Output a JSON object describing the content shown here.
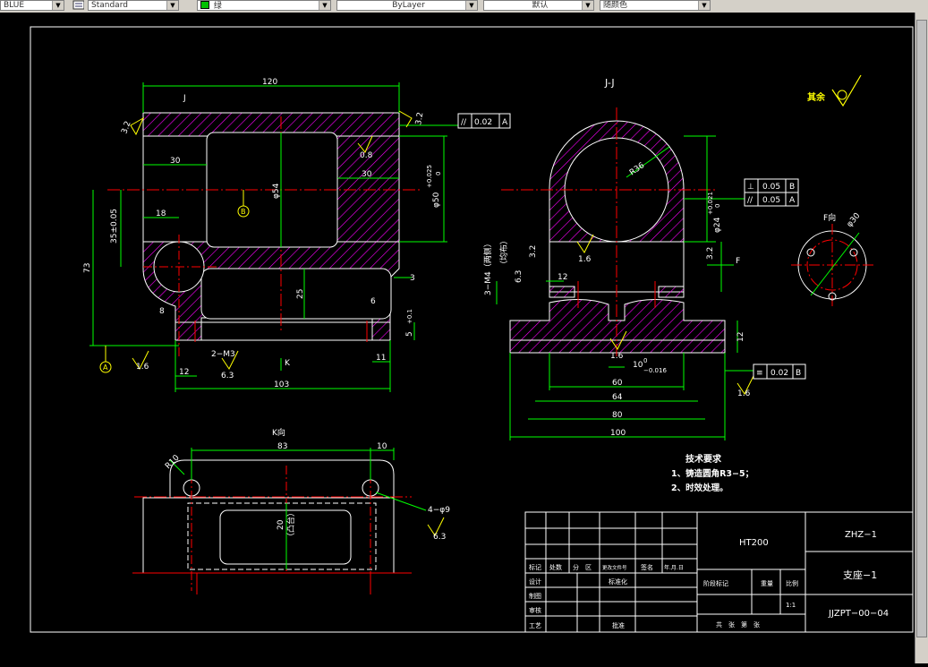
{
  "toolbar": {
    "layer": "BLUE",
    "text_style": "Standard",
    "color": "绿",
    "linetype": "ByLayer",
    "lineweight": "默认",
    "plot_style": "随颜色"
  },
  "colors": {
    "outline": "#ffffff",
    "dimension": "#00ff00",
    "centerline": "#ff0000",
    "hatch": "#ff00ff",
    "label": "#ffff00"
  },
  "drawing": {
    "front_view": {
      "section_label": "J",
      "dim_width": "120",
      "dim_30_left": "30",
      "dim_30_right": "30",
      "dim_18": "18",
      "dim_35": "35±0.05",
      "dim_73": "73",
      "dim_54": "φ54",
      "dim_50": "φ50",
      "tol_50": "+0.025",
      "tol_50b": "0",
      "dim_25": "25",
      "dim_3": "3",
      "dim_6": "6",
      "dim_5": "5",
      "tol_5": "+0.1",
      "dim_11": "11",
      "dim_12": "12",
      "dim_103": "103",
      "dim_8": "8",
      "dim_m3": "2−M3",
      "rough_32_left": "3.2",
      "rough_32_right": "3.2",
      "rough_08": "0.8",
      "rough_16": "1.6",
      "rough_63": "6.3",
      "datum_b": "B",
      "datum_a": "A",
      "view_k_arrow": "K",
      "tol_parallel_symbol": "//",
      "tol_parallel_val": "0.02",
      "tol_parallel_ref": "A"
    },
    "section_view": {
      "title": "J-J",
      "dim_r36": "R36",
      "dim_24": "φ24",
      "tol_24": "+0.021",
      "tol_24b": "0",
      "dim_m4": "3−M4（两侧）",
      "dim_m4_b": "（均布）",
      "rough_63": "6.3",
      "rough_32_left": "3.2",
      "rough_32_right": "3.2",
      "rough_16": "1.6",
      "rough_16b": "1.6",
      "rough_16c": "1.6",
      "dim_12": "12",
      "dim_10": "10",
      "tol_10": "0",
      "tol_10b": "−0.016",
      "dim_60": "60",
      "dim_64": "64",
      "dim_80": "80",
      "dim_100": "100",
      "dim_12v": "12",
      "arrow_f": "F",
      "tol_perp_symbol": "⊥",
      "tol_perp_val": "0.05",
      "tol_perp_ref": "B",
      "tol_par_symbol": "//",
      "tol_par_val": "0.05",
      "tol_par_ref": "A",
      "tol_sym_symbol": "≡",
      "tol_sym_val": "0.02",
      "tol_sym_ref": "B"
    },
    "f_view": {
      "title": "F向",
      "dim": "φ30"
    },
    "k_view": {
      "title": "K向",
      "dim_83": "83",
      "dim_10": "10",
      "dim_r10": "R10",
      "dim_20": "20",
      "dim_20_note": "（凸台）",
      "dim_holes": "4−φ9",
      "rough_63": "6.3"
    },
    "other_surfaces": {
      "label": "其余"
    },
    "tech_req": {
      "title": "技术要求",
      "line1": "1、铸造圆角R3−5；",
      "line2": "2、时效处理。"
    },
    "title_block": {
      "material": "HT200",
      "code": "ZHZ−1",
      "name": "支座−1",
      "drawing_no": "JJZPT−00−04",
      "scale": "1:1",
      "col_mark": "标记",
      "col_count": "处数",
      "col_zone": "分　区",
      "col_file": "更改文件号",
      "col_sign": "签名",
      "col_date": "年.月.日",
      "row_design": "设计",
      "row_standard": "标准化",
      "row_draw": "制图",
      "row_review": "审核",
      "row_process": "工艺",
      "row_approve": "批准",
      "stage_mark": "阶段标记",
      "weight": "重量",
      "ratio": "比例",
      "sheets": "共　张　第　张"
    }
  }
}
